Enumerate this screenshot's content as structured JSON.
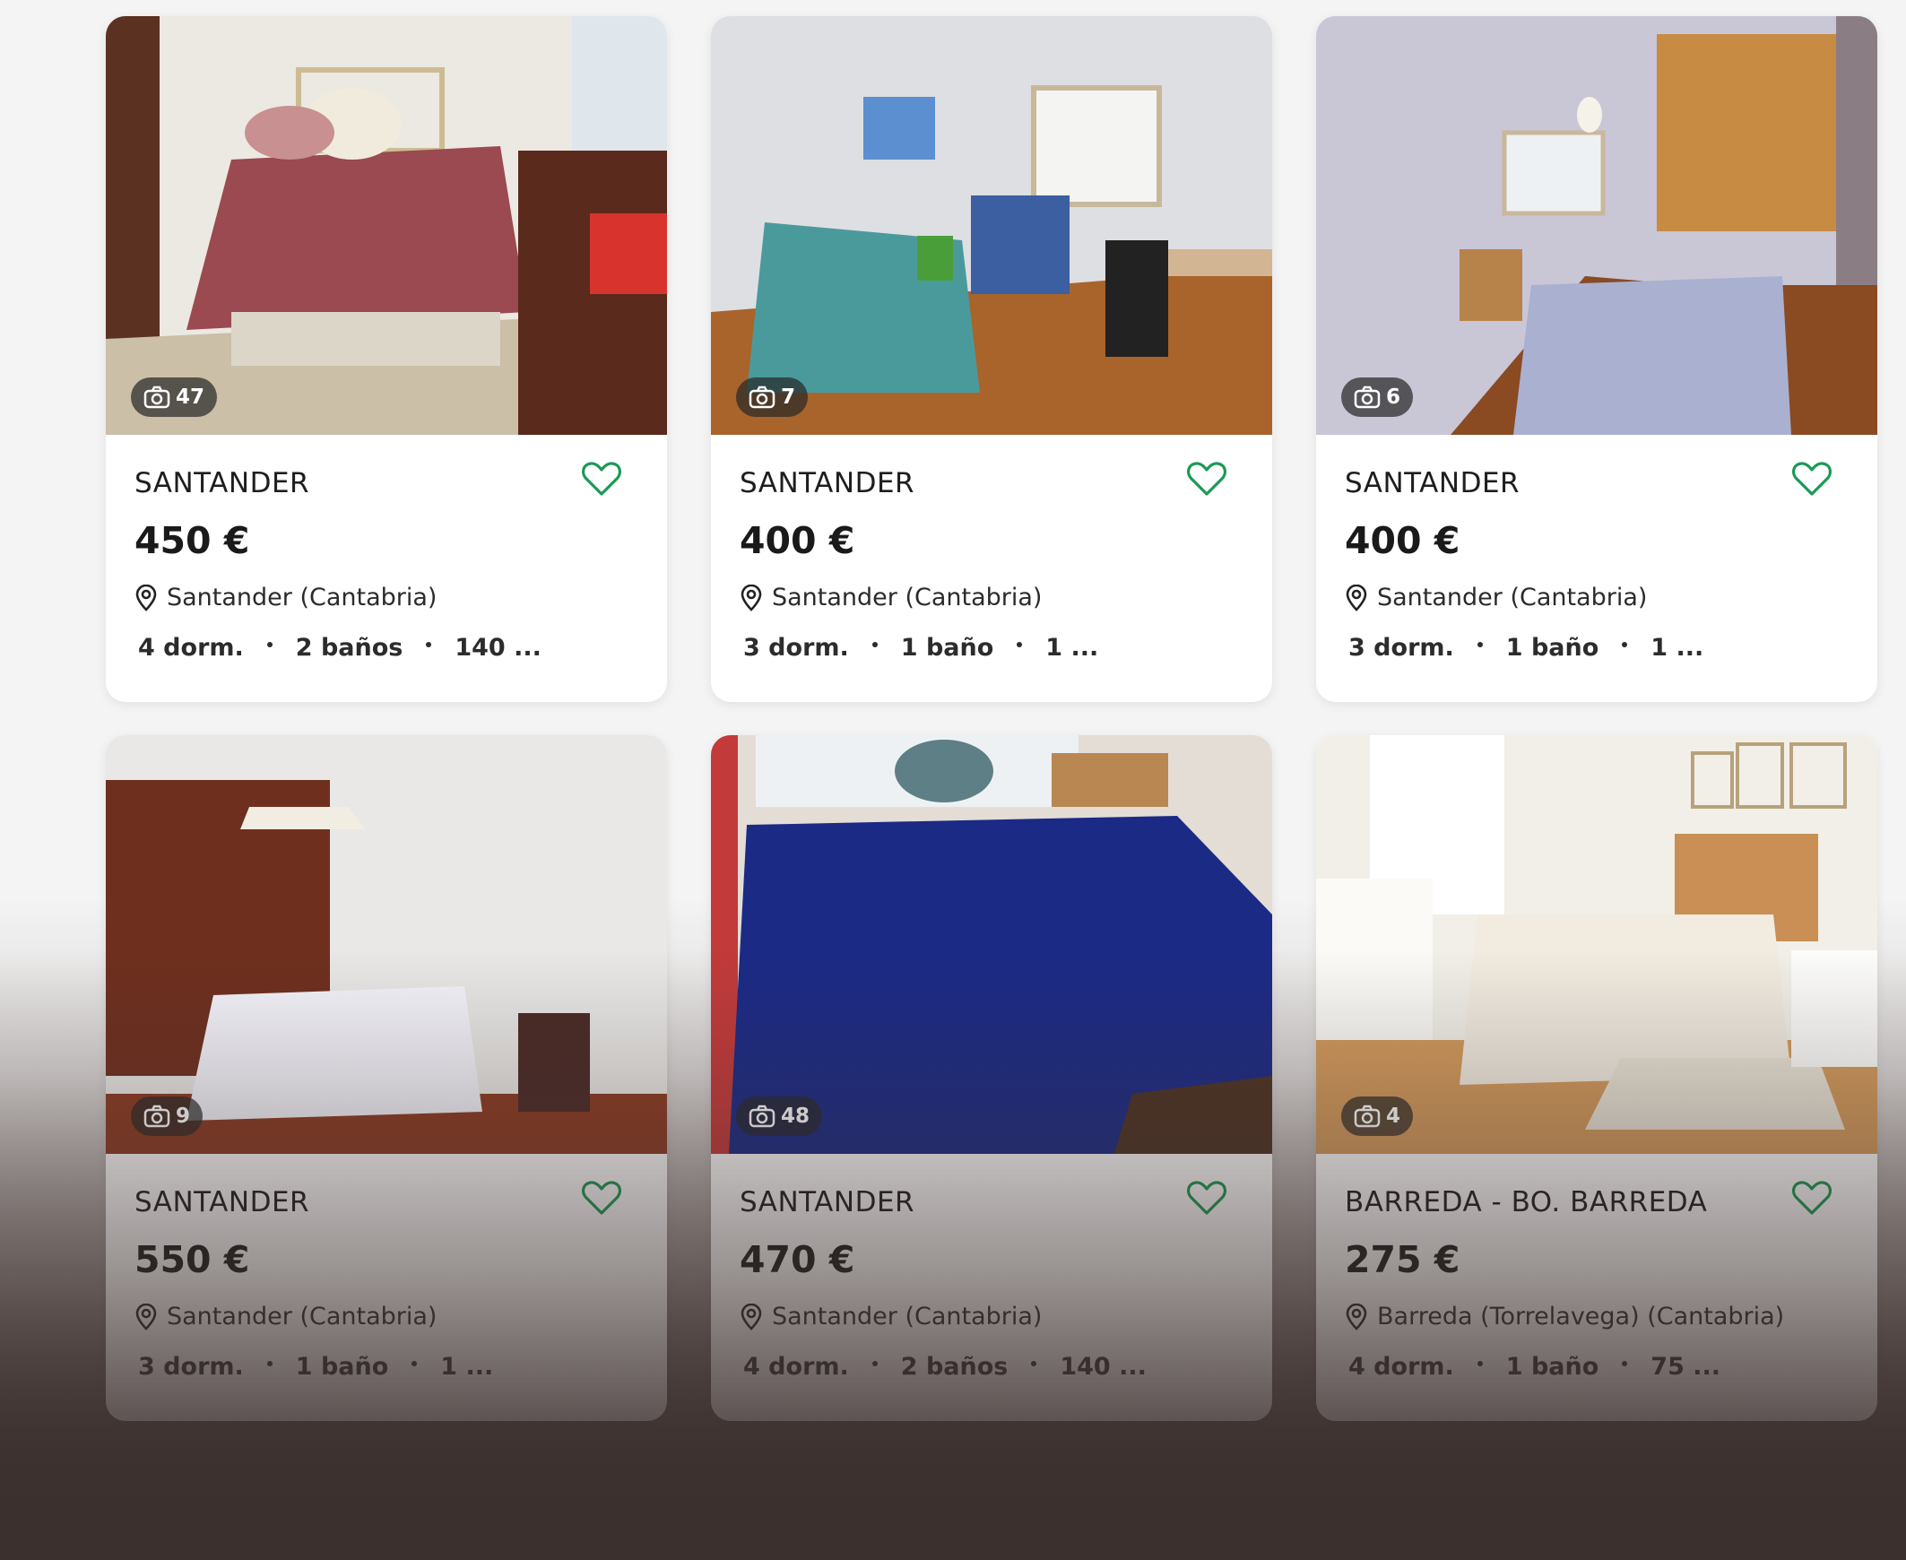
{
  "listings": [
    {
      "city": "SANTANDER",
      "price": "450 €",
      "location": "Santander (Cantabria)",
      "photos": "47",
      "feat1": "4 dorm.",
      "feat2": "2 baños",
      "feat3": "140 ..."
    },
    {
      "city": "SANTANDER",
      "price": "400 €",
      "location": "Santander (Cantabria)",
      "photos": "7",
      "feat1": "3 dorm.",
      "feat2": "1 baño",
      "feat3": "1 ..."
    },
    {
      "city": "SANTANDER",
      "price": "400 €",
      "location": "Santander (Cantabria)",
      "photos": "6",
      "feat1": "3 dorm.",
      "feat2": "1 baño",
      "feat3": "1 ..."
    },
    {
      "city": "SANTANDER",
      "price": "550 €",
      "location": "Santander (Cantabria)",
      "photos": "9",
      "feat1": "3 dorm.",
      "feat2": "1 baño",
      "feat3": "1 ..."
    },
    {
      "city": "SANTANDER",
      "price": "470 €",
      "location": "Santander (Cantabria)",
      "photos": "48",
      "feat1": "4 dorm.",
      "feat2": "2 baños",
      "feat3": "140 ..."
    },
    {
      "city": "BARREDA - BO. BARREDA",
      "price": "275 €",
      "location": "Barreda (Torrelavega) (Cantabria)",
      "photos": "4",
      "feat1": "4 dorm.",
      "feat2": "1 baño",
      "feat3": "75 ..."
    }
  ],
  "icons": {
    "favorite": "heart-outline-icon",
    "location": "location-pin-icon",
    "photos": "camera-icon"
  },
  "colors": {
    "favorite": "#1a9a55",
    "text": "#1e1e1e"
  }
}
